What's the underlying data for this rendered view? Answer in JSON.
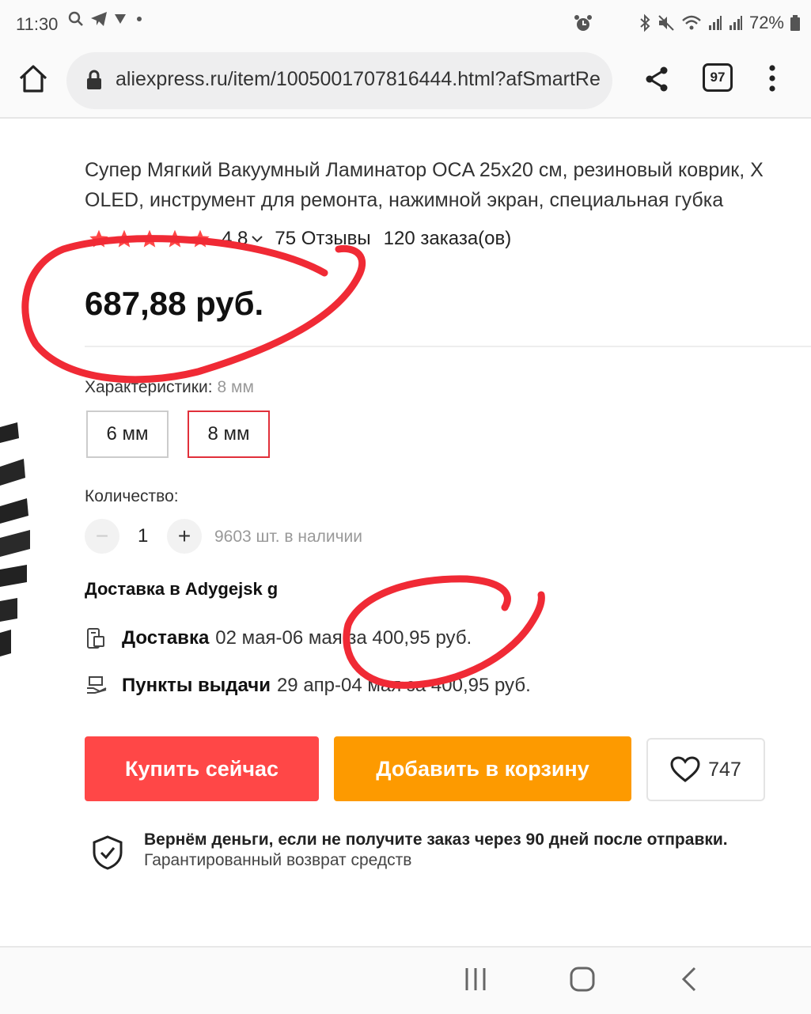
{
  "status": {
    "time": "11:30",
    "battery": "72%"
  },
  "browser": {
    "url": "aliexpress.ru/item/1005001707816444.html?afSmartRe",
    "tab_count": "97"
  },
  "product": {
    "title_line1": "Супер Мягкий Вакуумный Ламинатор OCA 25x20 см, резиновый коврик, Х",
    "title_line2": "OLED, инструмент для ремонта, нажимной экран, специальная губка",
    "rating": "4.8",
    "reviews": "75 Отзывы",
    "orders": "120 заказа(ов)",
    "stars": 5,
    "price": "687,88 руб."
  },
  "options": {
    "label": "Характеристики:",
    "selected": "8 мм",
    "items": [
      "6 мм",
      "8 мм"
    ]
  },
  "quantity": {
    "label": "Количество:",
    "minus": "−",
    "plus": "+",
    "value": "1",
    "stock": "9603 шт. в наличии"
  },
  "shipping": {
    "heading": "Доставка в Adygejsk g",
    "delivery_label": "Доставка",
    "delivery_text": "02 мая-06 мая за 400,95 руб.",
    "pickup_label": "Пункты выдачи",
    "pickup_text": "29 апр-04 мая за 400,95 руб."
  },
  "actions": {
    "buy": "Купить сейчас",
    "cart": "Добавить в корзину",
    "wishlist_count": "747"
  },
  "guarantee": {
    "title": "Вернём деньги, если не получите заказ через 90 дней после отправки.",
    "subtitle": "Гарантированный возврат средств"
  },
  "colors": {
    "buy": "#ff4747",
    "cart": "#fd9a00",
    "star": "#ff4747",
    "selected_border": "#e1303a",
    "annotation": "#f02a35"
  }
}
